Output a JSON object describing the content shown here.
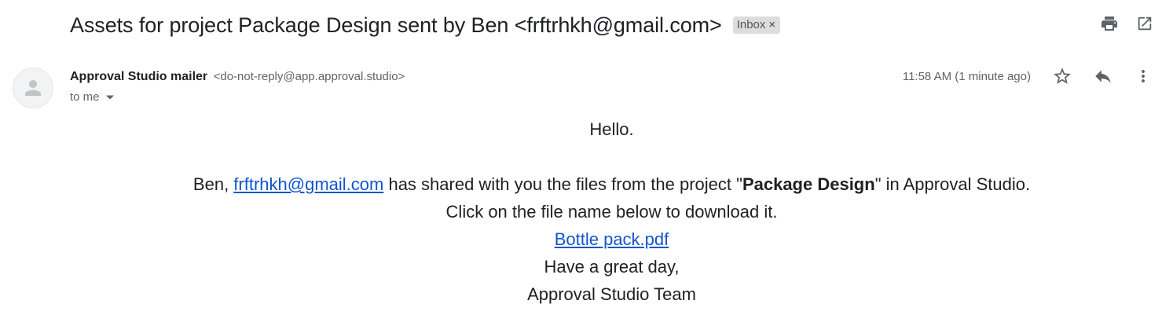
{
  "email": {
    "subject": "Assets for project Package Design sent by Ben <frftrhkh@gmail.com>",
    "label": "Inbox",
    "label_remove": "×",
    "sender_name": "Approval Studio mailer",
    "sender_email": "<do-not-reply@app.approval.studio>",
    "recipient": "to me",
    "timestamp": "11:58 AM (1 minute ago)"
  },
  "body": {
    "greeting": "Hello.",
    "line1_prefix": "Ben, ",
    "line1_link": "frftrhkh@gmail.com",
    "line1_middle": " has shared with you the files from the project \"",
    "line1_project": "Package Design",
    "line1_suffix": "\" in Approval Studio.",
    "line2": "Click on the file name below to download it.",
    "file_link": "Bottle pack.pdf",
    "closing": "Have a great day,",
    "signature": "Approval Studio Team"
  },
  "icons": {
    "print": "print-icon",
    "popout": "open-in-new-window-icon",
    "star": "star-icon",
    "reply": "reply-icon",
    "more": "more-vert-icon",
    "avatar": "person-icon",
    "dropdown": "caret-down-icon"
  },
  "colors": {
    "link": "#1155cc",
    "chip_bg": "#dddddd",
    "icon": "#5f6368"
  }
}
